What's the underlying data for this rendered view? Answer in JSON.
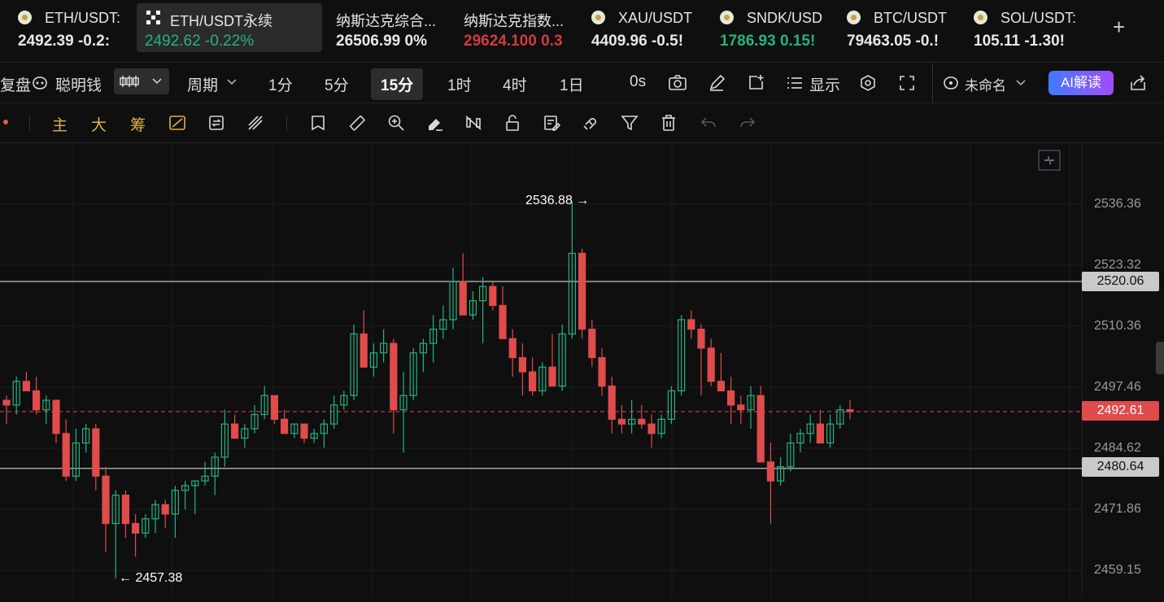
{
  "tickers": [
    {
      "name": "ETH/USDT:",
      "price": "2492.39",
      "change": "-0.2:",
      "color": "#e8e8e8",
      "icon": "eth-coin-icon"
    },
    {
      "name": "ETH/USDT永续",
      "price": "2492.62",
      "change": "-0.22%",
      "color": "#23b37f",
      "icon": "okx-logo-icon",
      "active": true
    },
    {
      "name": "纳斯达克综合...",
      "price": "26506.99",
      "change": "0%",
      "color": "#e8e8e8"
    },
    {
      "name": "纳斯达克指数...",
      "price": "29624.100",
      "change": "0.3",
      "color": "#d23b3b"
    },
    {
      "name": "XAU/USDT",
      "price": "4409.96",
      "change": "-0.5!",
      "color": "#e8e8e8",
      "icon": "coin-icon"
    },
    {
      "name": "SNDK/USD",
      "price": "1786.93",
      "change": "0.15!",
      "color": "#23b37f",
      "icon": "coin-icon"
    },
    {
      "name": "BTC/USDT",
      "price": "79463.05",
      "change": "-0.!",
      "color": "#e8e8e8",
      "icon": "coin-icon"
    },
    {
      "name": "SOL/USDT:",
      "price": "105.11",
      "change": "-1.30!",
      "color": "#e8e8e8",
      "icon": "coin-icon"
    }
  ],
  "toolbar": {
    "fupan": "复盘",
    "smart_money": "聪明钱",
    "period": "周期",
    "intervals": [
      "1分",
      "5分",
      "15分",
      "1时",
      "4时",
      "1日"
    ],
    "selected_interval": "15分",
    "countdown": "0s",
    "display": "显示",
    "layout_name": "未命名",
    "ai_button": "AI解读"
  },
  "drawing_toolbar": {
    "zhu": "主",
    "da": "大",
    "chou": "筹"
  },
  "chart": {
    "high_label": "2536.88 →",
    "low_label": "← 2457.38",
    "y_ticks": [
      "2536.36",
      "2523.32",
      "2510.36",
      "2497.46",
      "2484.62",
      "2471.86",
      "2459.15"
    ],
    "resistance_price": "2520.06",
    "support_price": "2480.64",
    "current_price": "2492.61",
    "colors": {
      "up": "#23b37f",
      "down": "#e04b4b",
      "bg": "#0f0f10",
      "current": "#e04b4b"
    }
  },
  "candles": [
    [
      2495,
      2496,
      2490,
      2494
    ],
    [
      2494,
      2500,
      2492,
      2499
    ],
    [
      2499,
      2501,
      2497,
      2497
    ],
    [
      2497,
      2500,
      2492,
      2493
    ],
    [
      2493,
      2496,
      2490,
      2495
    ],
    [
      2495,
      2495,
      2486,
      2488
    ],
    [
      2488,
      2491,
      2478,
      2479
    ],
    [
      2479,
      2489,
      2478,
      2486
    ],
    [
      2486,
      2490,
      2484,
      2489
    ],
    [
      2489,
      2490,
      2476,
      2479
    ],
    [
      2479,
      2481,
      2463,
      2469
    ],
    [
      2469,
      2476,
      2457.38,
      2475
    ],
    [
      2475,
      2476,
      2466,
      2469
    ],
    [
      2469,
      2471,
      2462,
      2467
    ],
    [
      2467,
      2471,
      2466,
      2470
    ],
    [
      2470,
      2474,
      2467,
      2473
    ],
    [
      2473,
      2474,
      2468,
      2471
    ],
    [
      2471,
      2477,
      2466,
      2476
    ],
    [
      2476,
      2478,
      2472,
      2477
    ],
    [
      2477,
      2478,
      2471,
      2478
    ],
    [
      2478,
      2482,
      2477,
      2479
    ],
    [
      2479,
      2484,
      2475,
      2483
    ],
    [
      2483,
      2493,
      2481,
      2490
    ],
    [
      2490,
      2492,
      2487,
      2487
    ],
    [
      2487,
      2490,
      2485,
      2489
    ],
    [
      2489,
      2494,
      2488,
      2492
    ],
    [
      2492,
      2498,
      2491,
      2496
    ],
    [
      2496,
      2496,
      2490,
      2491
    ],
    [
      2491,
      2493,
      2488,
      2488
    ],
    [
      2488,
      2490,
      2487,
      2490
    ],
    [
      2490,
      2490,
      2486,
      2487
    ],
    [
      2487,
      2489,
      2486,
      2488
    ],
    [
      2488,
      2491,
      2485,
      2490
    ],
    [
      2490,
      2496,
      2489,
      2494
    ],
    [
      2494,
      2497,
      2493,
      2496
    ],
    [
      2496,
      2511,
      2495,
      2509
    ],
    [
      2509,
      2514,
      2503,
      2502
    ],
    [
      2502,
      2507,
      2500,
      2505
    ],
    [
      2505,
      2510,
      2503,
      2507
    ],
    [
      2507,
      2508,
      2488,
      2493
    ],
    [
      2493,
      2501,
      2484,
      2496
    ],
    [
      2496,
      2506,
      2495,
      2505
    ],
    [
      2505,
      2508,
      2501,
      2507
    ],
    [
      2507,
      2513,
      2503,
      2510
    ],
    [
      2510,
      2515,
      2508,
      2512
    ],
    [
      2512,
      2523,
      2510,
      2520
    ],
    [
      2520,
      2526,
      2513,
      2513
    ],
    [
      2513,
      2518,
      2512,
      2516
    ],
    [
      2516,
      2521,
      2507,
      2519
    ],
    [
      2519,
      2520,
      2514,
      2515
    ],
    [
      2515,
      2519,
      2510,
      2508
    ],
    [
      2508,
      2510,
      2500,
      2504
    ],
    [
      2504,
      2507,
      2496,
      2501
    ],
    [
      2501,
      2504,
      2496,
      2497
    ],
    [
      2497,
      2503,
      2496,
      2502
    ],
    [
      2502,
      2509,
      2498,
      2498
    ],
    [
      2498,
      2511,
      2497,
      2509
    ],
    [
      2509,
      2536.88,
      2508,
      2526
    ],
    [
      2526,
      2527,
      2508,
      2510
    ],
    [
      2510,
      2512,
      2502,
      2504
    ],
    [
      2504,
      2506,
      2496,
      2498
    ],
    [
      2498,
      2500,
      2488,
      2491
    ],
    [
      2491,
      2494,
      2488,
      2490
    ],
    [
      2490,
      2495,
      2488,
      2491
    ],
    [
      2491,
      2494,
      2489,
      2490
    ],
    [
      2490,
      2492,
      2485,
      2488
    ],
    [
      2488,
      2492,
      2487,
      2491
    ],
    [
      2491,
      2498,
      2490,
      2497
    ],
    [
      2497,
      2513,
      2496,
      2512
    ],
    [
      2512,
      2514,
      2508,
      2510
    ],
    [
      2510,
      2511,
      2496,
      2506
    ],
    [
      2506,
      2508,
      2498,
      2499
    ],
    [
      2499,
      2505,
      2497,
      2497
    ],
    [
      2497,
      2500,
      2490,
      2494
    ],
    [
      2494,
      2496,
      2490,
      2493
    ],
    [
      2493,
      2498,
      2489,
      2496
    ],
    [
      2496,
      2498,
      2482,
      2482
    ],
    [
      2482,
      2486,
      2469,
      2478
    ],
    [
      2478,
      2483,
      2477,
      2481
    ],
    [
      2481,
      2488,
      2480,
      2486
    ],
    [
      2486,
      2489,
      2484,
      2488
    ],
    [
      2488,
      2492,
      2486,
      2490
    ],
    [
      2490,
      2493,
      2488,
      2486
    ],
    [
      2486,
      2492,
      2485,
      2490
    ],
    [
      2490,
      2494,
      2489,
      2493
    ],
    [
      2493,
      2495,
      2491,
      2492.61
    ]
  ]
}
